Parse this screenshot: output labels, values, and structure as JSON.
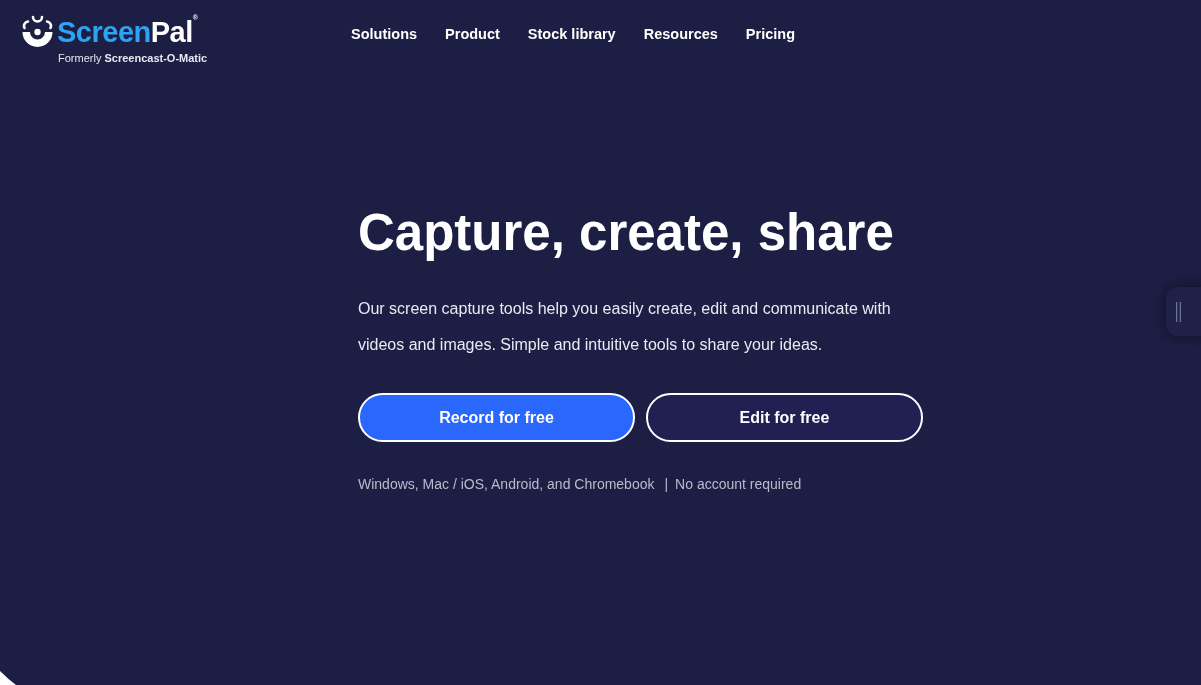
{
  "logo": {
    "wordmark": [
      "Screen",
      "Pal"
    ],
    "registered": "®",
    "tagline": "Formerly **Screencast-O-Matic**"
  },
  "nav": [
    "Solutions",
    "Product",
    "Stock library",
    "Resources",
    "Pricing"
  ],
  "hero": {
    "title": "Capture, create, share",
    "description": "Our screen capture tools help you easily create, edit and communicate with videos and images. Simple and intuitive tools to share your ideas.",
    "buttons": [
      {
        "label": "Record for free",
        "kind": "primary"
      },
      {
        "label": "Edit for free",
        "kind": "secondary"
      }
    ],
    "platforms": "Windows, Mac / iOS, Android, and Chromebook",
    "separator": "|",
    "note": "No account required"
  }
}
